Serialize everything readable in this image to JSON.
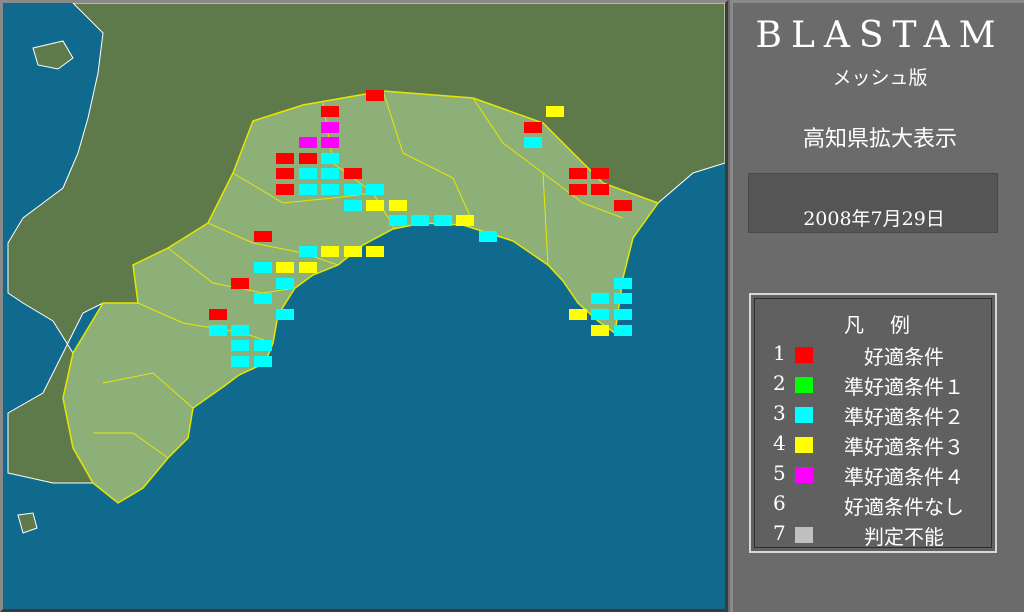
{
  "app": {
    "title": "BLASTAM",
    "subtitle": "メッシュ版",
    "view_title": "高知県拡大表示",
    "date": "2008年7月29日"
  },
  "legend": {
    "title": "凡例",
    "items": [
      {
        "number": "1",
        "label": "好適条件",
        "color": "#ff0000"
      },
      {
        "number": "2",
        "label": "準好適条件１",
        "color": "#00ff00"
      },
      {
        "number": "3",
        "label": "準好適条件２",
        "color": "#00ffff"
      },
      {
        "number": "4",
        "label": "準好適条件３",
        "color": "#ffff00"
      },
      {
        "number": "5",
        "label": "準好適条件４",
        "color": "#ff00ff"
      },
      {
        "number": "6",
        "label": "好適条件なし",
        "color": null
      },
      {
        "number": "7",
        "label": "判定不能",
        "color": "#c0c0c0"
      }
    ]
  },
  "map": {
    "colors": {
      "sea": "#0f6a8e",
      "land_outside": "#5f7a4a",
      "kochi": "#8db078",
      "border": "#e6e600",
      "coast": "#ffffff"
    }
  }
}
